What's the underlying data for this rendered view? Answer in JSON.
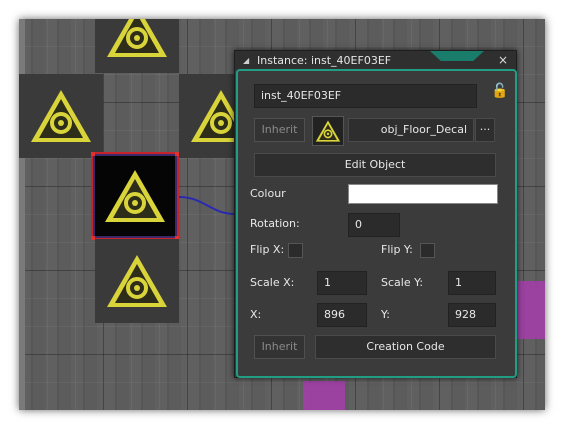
{
  "dialog": {
    "title": "Instance: inst_40EF03EF",
    "close_label": "×",
    "instance_name": "inst_40EF03EF",
    "inherit_label": "Inherit",
    "object_name": "obj_Floor_Decal",
    "more_label": "···",
    "edit_object_label": "Edit Object",
    "colour_label": "Colour",
    "colour_value": "#ffffff",
    "rotation_label": "Rotation:",
    "rotation_value": "0",
    "flip_x_label": "Flip X:",
    "flip_y_label": "Flip Y:",
    "scale_x_label": "Scale X:",
    "scale_x_value": "1",
    "scale_y_label": "Scale Y:",
    "scale_y_value": "1",
    "x_label": "X:",
    "x_value": "896",
    "y_label": "Y:",
    "y_value": "928",
    "inherit_bottom_label": "Inherit",
    "creation_code_label": "Creation Code",
    "accent_color": "#1f9e84"
  },
  "icons": {
    "decal": "biohazard-icon",
    "lock": "lock-icon",
    "collapse": "triangle-collapse-icon"
  }
}
